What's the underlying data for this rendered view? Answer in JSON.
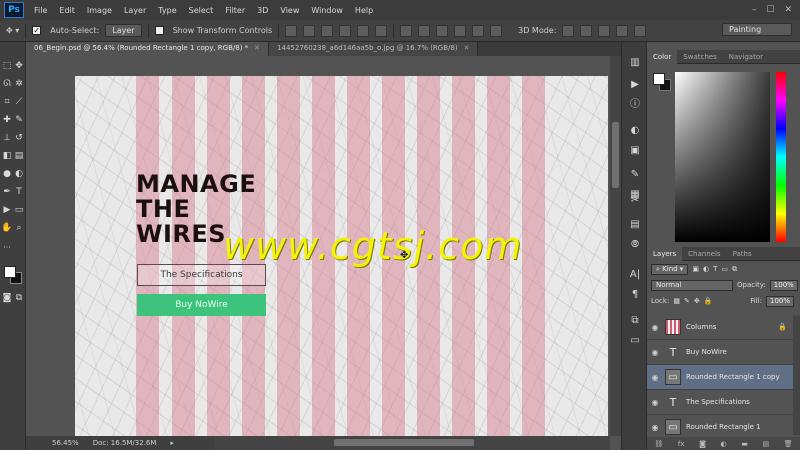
{
  "app": {
    "logo": "Ps"
  },
  "menu": [
    "File",
    "Edit",
    "Image",
    "Layer",
    "Type",
    "Select",
    "Filter",
    "3D",
    "View",
    "Window",
    "Help"
  ],
  "window_controls": [
    "–",
    "☐",
    "✕"
  ],
  "options": {
    "auto_select_label": "Auto-Select:",
    "auto_select_value": "Layer",
    "transform_label": "Show Transform Controls",
    "mode_3d_label": "3D Mode:",
    "workspace": "Painting"
  },
  "tabs": [
    {
      "label": "06_Begin.psd @ 56.4% (Rounded Rectangle 1 copy, RGB/8) *",
      "active": true
    },
    {
      "label": "14452760238_a6d146aa5b_o.jpg @ 16.7% (RGB/8)",
      "active": false
    }
  ],
  "canvas": {
    "headline": [
      "MANAGE",
      "THE",
      "WIRES"
    ],
    "spec_button": "The Specifications",
    "buy_button": "Buy NoWire",
    "watermark": "www.cgtsj.com",
    "column_color": "#d6768a",
    "buy_color": "#3ec37d"
  },
  "status": {
    "zoom": "56.45%",
    "doc": "Doc: 16.5M/32.6M"
  },
  "color_panel": {
    "tabs": [
      "Color",
      "Swatches",
      "Navigator"
    ]
  },
  "layers_panel": {
    "tabs": [
      "Layers",
      "Channels",
      "Paths"
    ],
    "filter": "Kind",
    "blend_mode": "Normal",
    "opacity_label": "Opacity:",
    "opacity": "100%",
    "lock_label": "Lock:",
    "fill_label": "Fill:",
    "fill": "100%",
    "layers": [
      {
        "name": "Columns",
        "kind": "cols",
        "locked": true,
        "selected": false
      },
      {
        "name": "Buy NoWire",
        "kind": "text",
        "locked": false,
        "selected": false
      },
      {
        "name": "Rounded Rectangle 1 copy",
        "kind": "rect",
        "locked": false,
        "selected": true
      },
      {
        "name": "The Specifications",
        "kind": "text",
        "locked": false,
        "selected": false
      },
      {
        "name": "Rounded Rectangle 1",
        "kind": "rect",
        "locked": false,
        "selected": false
      }
    ],
    "bottom_icons": [
      "link-icon",
      "fx-icon",
      "mask-icon",
      "adjustment-icon",
      "folder-icon",
      "new-layer-icon",
      "trash-icon"
    ]
  }
}
